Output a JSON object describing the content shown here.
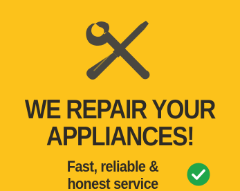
{
  "headline": {
    "line1": "WE REPAIR YOUR",
    "line2": "APPLIANCES!"
  },
  "tagline": {
    "line1": "Fast, reliable &",
    "line2": "honest service"
  },
  "icons": {
    "tools": "wrench-and-screwdriver-icon",
    "check": "check-circle-icon"
  },
  "colors": {
    "background": "#fcc21b",
    "text": "#2e2b26",
    "tools": "#4a4740",
    "check_circle": "#1fa64a",
    "check_mark": "#ffffff"
  }
}
